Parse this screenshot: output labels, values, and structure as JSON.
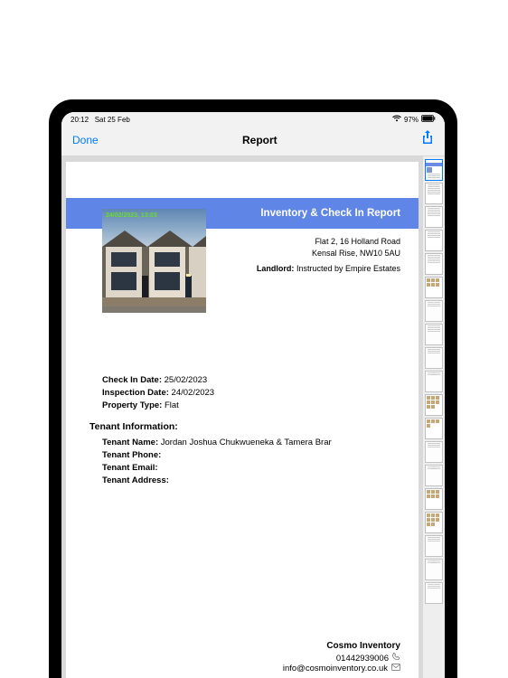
{
  "status": {
    "time": "20:12",
    "date": "Sat 25 Feb",
    "battery_pct": "97%"
  },
  "navbar": {
    "done": "Done",
    "title": "Report"
  },
  "banner": {
    "title": "Inventory & Check In Report"
  },
  "photo": {
    "timestamp": "24/02/2023, 13:03"
  },
  "address": {
    "line1": "Flat 2, 16 Holland Road",
    "line2": "Kensal Rise, NW10 5AU",
    "landlord_label": "Landlord:",
    "landlord_value": "Instructed by Empire Estates"
  },
  "details": {
    "checkin_label": "Check In Date:",
    "checkin_value": "25/02/2023",
    "inspection_label": "Inspection Date:",
    "inspection_value": "24/02/2023",
    "proptype_label": "Property Type:",
    "proptype_value": "Flat",
    "tenant_section": "Tenant Information:",
    "tenant_name_label": "Tenant Name:",
    "tenant_name_value": "Jordan Joshua Chukwueneka & Tamera Brar",
    "tenant_phone_label": "Tenant Phone:",
    "tenant_phone_value": "",
    "tenant_email_label": "Tenant Email:",
    "tenant_email_value": "",
    "tenant_addr_label": "Tenant Address:",
    "tenant_addr_value": ""
  },
  "footer": {
    "company": "Cosmo Inventory",
    "phone": "01442939006",
    "email": "info@cosmoinventory.co.uk"
  }
}
